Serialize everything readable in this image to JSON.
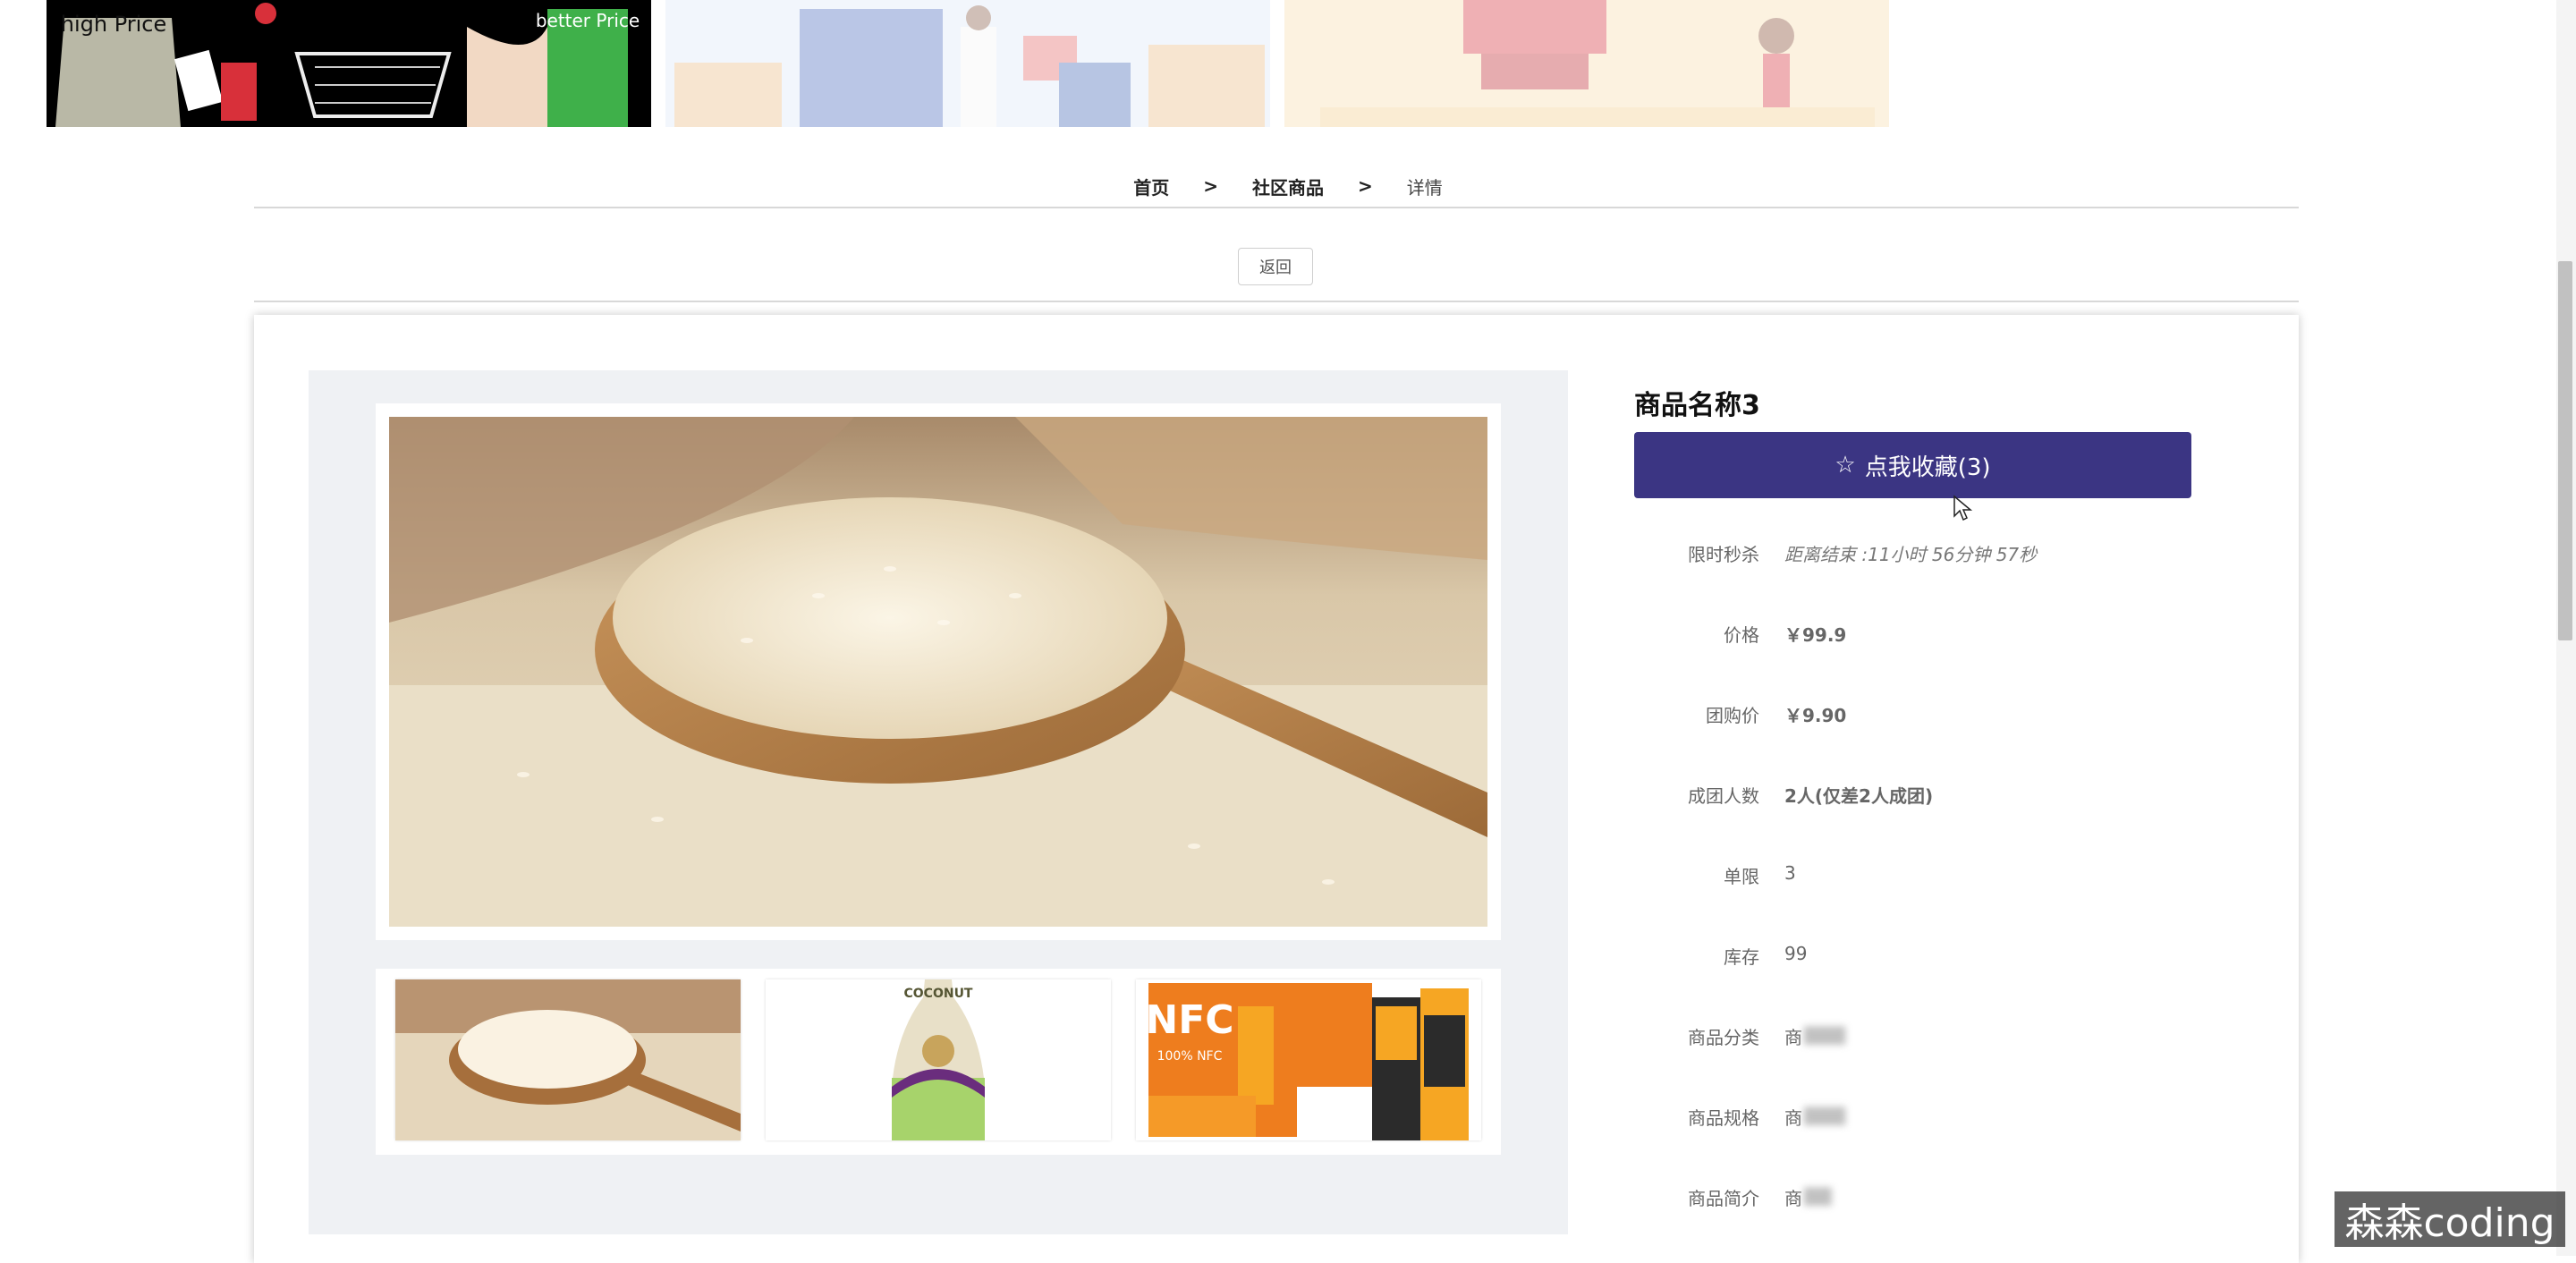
{
  "breadcrumb": {
    "items": [
      "首页",
      "社区商品",
      "详情"
    ],
    "separator": ">"
  },
  "back_button": "返回",
  "product": {
    "name": "商品名称3",
    "favorite_label": "点我收藏(3)",
    "favorite_icon": "star-outline-icon",
    "rows": [
      {
        "label": "限时秒杀",
        "value": "距离结束 :11小时 56分钟 57秒"
      },
      {
        "label": "价格",
        "value": "￥99.9"
      },
      {
        "label": "团购价",
        "value": "￥9.90"
      },
      {
        "label": "成团人数",
        "value": "2人(仅差2人成团)"
      },
      {
        "label": "单限",
        "value": "3"
      },
      {
        "label": "库存",
        "value": "99"
      },
      {
        "label": "商品分类",
        "value": "商"
      },
      {
        "label": "商品规格",
        "value": "商"
      },
      {
        "label": "商品简介",
        "value": "商"
      }
    ]
  },
  "banner_texts": {
    "bag_left": "high Price",
    "bag_right": "better Price"
  },
  "thumbnails": {
    "coconut_label": "COCONUT",
    "nfc_label": "NFC",
    "nfc_sub": "100% NFC"
  },
  "watermark": "森森coding",
  "colors": {
    "accent": "#3b3583",
    "gallery_bg": "#eff1f4"
  }
}
